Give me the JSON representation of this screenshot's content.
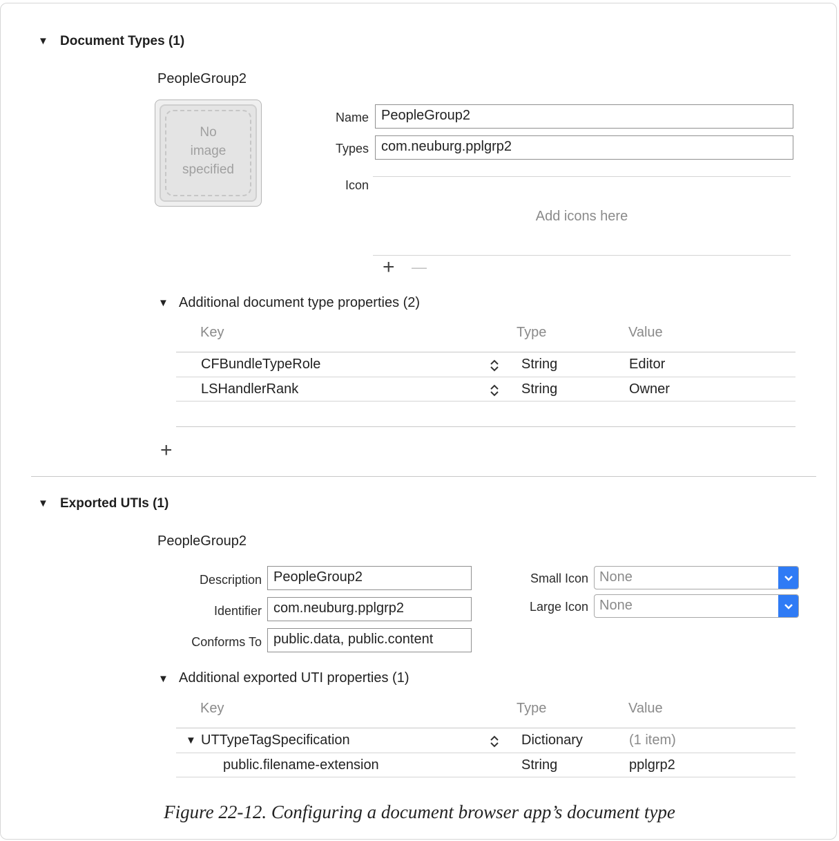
{
  "document_types": {
    "header": "Document Types (1)",
    "item_title": "PeopleGroup2",
    "image_placeholder_lines": [
      "No",
      "image",
      "specified"
    ],
    "name_label": "Name",
    "name_value": "PeopleGroup2",
    "types_label": "Types",
    "types_value": "com.neuburg.pplgrp2",
    "icon_label": "Icon",
    "icon_placeholder": "Add icons here",
    "add_symbol": "+",
    "remove_symbol": "—",
    "additional": {
      "header": "Additional document type properties (2)",
      "columns": [
        "Key",
        "Type",
        "Value"
      ],
      "rows": [
        {
          "key": "CFBundleTypeRole",
          "type": "String",
          "value": "Editor"
        },
        {
          "key": "LSHandlerRank",
          "type": "String",
          "value": "Owner"
        }
      ],
      "add_symbol": "+"
    }
  },
  "exported_utis": {
    "header": "Exported UTIs (1)",
    "item_title": "PeopleGroup2",
    "description_label": "Description",
    "description_value": "PeopleGroup2",
    "identifier_label": "Identifier",
    "identifier_value": "com.neuburg.pplgrp2",
    "conforms_label": "Conforms To",
    "conforms_value": "public.data, public.content",
    "small_icon_label": "Small Icon",
    "small_icon_value": "None",
    "large_icon_label": "Large Icon",
    "large_icon_value": "None",
    "additional": {
      "header": "Additional exported UTI properties (1)",
      "columns": [
        "Key",
        "Type",
        "Value"
      ],
      "rows": [
        {
          "key": "UTTypeTagSpecification",
          "type": "Dictionary",
          "value": "(1 item)"
        },
        {
          "key": "public.filename-extension",
          "type": "String",
          "value": "pplgrp2"
        }
      ]
    }
  },
  "caption": "Figure 22-12. Configuring a document browser app’s document type",
  "colors": {
    "accent": "#2f7bf5",
    "separator": "#d4d4d4"
  }
}
